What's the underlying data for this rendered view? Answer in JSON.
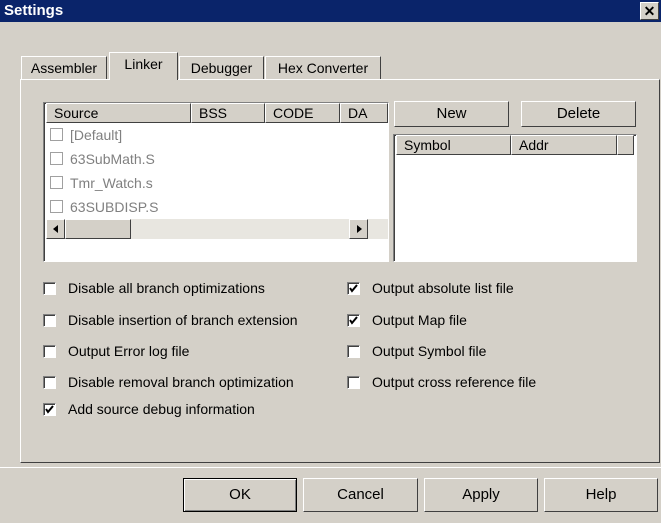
{
  "window": {
    "title": "Settings",
    "close_glyph": "✕"
  },
  "tabs": [
    {
      "label": "Assembler",
      "active": false
    },
    {
      "label": "Linker",
      "active": true
    },
    {
      "label": "Debugger",
      "active": false
    },
    {
      "label": "Hex Converter",
      "active": false
    }
  ],
  "source_list": {
    "columns": [
      "Source",
      "BSS",
      "CODE",
      "DA"
    ],
    "rows": [
      "[Default]",
      "63SubMath.S",
      "Tmr_Watch.s",
      "63SUBDISP.S"
    ]
  },
  "symbol_list": {
    "columns": [
      "Symbol",
      "Addr"
    ]
  },
  "buttons": {
    "new": "New",
    "delete": "Delete",
    "ok": "OK",
    "cancel": "Cancel",
    "apply": "Apply",
    "help": "Help"
  },
  "options_left": [
    {
      "label": "Disable all branch optimizations",
      "checked": false
    },
    {
      "label": "Disable insertion of branch extension",
      "checked": false
    },
    {
      "label": "Output Error log file",
      "checked": false
    },
    {
      "label": "Disable removal branch optimization",
      "checked": false
    },
    {
      "label": "Add source debug information",
      "checked": true
    }
  ],
  "options_right": [
    {
      "label": "Output absolute list file",
      "checked": true
    },
    {
      "label": "Output Map file",
      "checked": true
    },
    {
      "label": "Output Symbol file",
      "checked": false
    },
    {
      "label": "Output cross reference file",
      "checked": false
    }
  ]
}
